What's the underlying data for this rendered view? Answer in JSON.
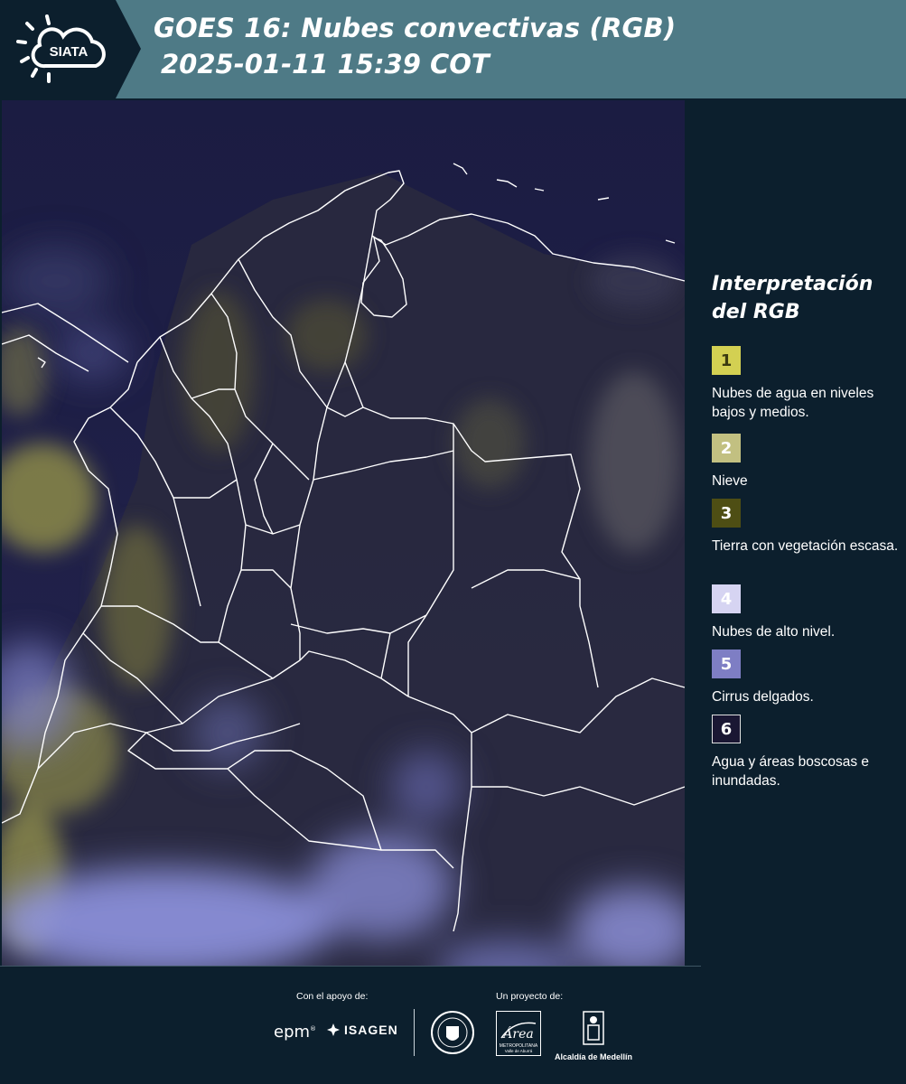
{
  "header": {
    "logo_text": "SIATA",
    "title_line1": "GOES 16: Nubes convectivas (RGB)",
    "title_line2": "2025-01-11 15:39 COT"
  },
  "map": {
    "icon": "satellite-map",
    "ocean_color": "#1d1d45",
    "cloud_low_color": "#c8c45a",
    "cloud_high_color": "#a9aef0",
    "border_color": "#ffffff"
  },
  "legend": {
    "title": "Interpretación del RGB",
    "items": [
      {
        "number": "1",
        "label": "Nubes de agua en niveles bajos y medios.",
        "color": "#d3d052",
        "text_color": "#3a3a10"
      },
      {
        "number": "2",
        "label": "Nieve",
        "color": "#c2c081",
        "text_color": "#ffffff"
      },
      {
        "number": "3",
        "label": "Tierra con vegetación escasa.",
        "color": "#4e4e14",
        "text_color": "#ffffff"
      },
      {
        "number": "4",
        "label": "Nubes de alto nivel.",
        "color": "#d6d4f2",
        "text_color": "#ffffff"
      },
      {
        "number": "5",
        "label": "Cirrus delgados.",
        "color": "#7e7ec4",
        "text_color": "#ffffff"
      },
      {
        "number": "6",
        "label": "Agua y áreas boscosas e inundadas.",
        "color": "#1a1733",
        "text_color": "#ffffff"
      }
    ]
  },
  "footer": {
    "support_label": "Con el apoyo de:",
    "project_label": "Un proyecto de:",
    "epm_logo": "epm",
    "isagen_logo": "ISAGEN",
    "metro_logo_title": "Área",
    "metro_logo_sub1": "METROPOLITANA",
    "metro_logo_sub2": "Valle de Aburrá",
    "alcaldia_logo": "Alcaldía de Medellín"
  }
}
